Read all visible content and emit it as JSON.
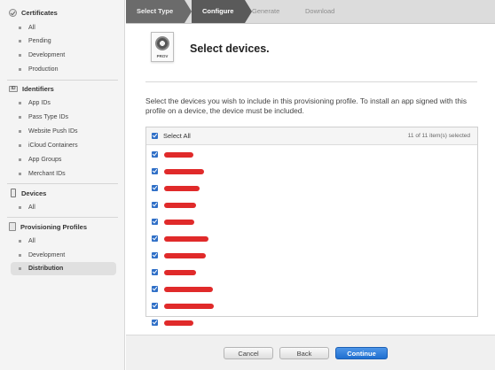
{
  "sidebar": {
    "sections": [
      {
        "title": "Certificates",
        "icon": "certificate-icon",
        "items": [
          "All",
          "Pending",
          "Development",
          "Production"
        ]
      },
      {
        "title": "Identifiers",
        "icon": "id-card-icon",
        "items": [
          "App IDs",
          "Pass Type IDs",
          "Website Push IDs",
          "iCloud Containers",
          "App Groups",
          "Merchant IDs"
        ]
      },
      {
        "title": "Devices",
        "icon": "iphone-icon",
        "items": [
          "All"
        ]
      },
      {
        "title": "Provisioning Profiles",
        "icon": "provisioning-profile-icon",
        "items": [
          "All",
          "Development",
          "Distribution"
        ]
      }
    ],
    "active_item": "Distribution"
  },
  "steps": [
    "Select Type",
    "Configure",
    "Generate",
    "Download"
  ],
  "current_step": "Configure",
  "header": {
    "icon_label": "PROV",
    "title": "Select devices."
  },
  "description": "Select the devices you wish to include in this provisioning profile. To install an app signed with this profile on a device, the device must be included.",
  "device_list": {
    "select_all_label": "Select All",
    "selection_count": "11 of 11 item(s) selected",
    "redaction_color": "#e02a2a",
    "checkbox_color": "#2f6fc7",
    "devices": [
      {
        "name": "",
        "checked": true
      },
      {
        "name": "",
        "checked": true
      },
      {
        "name": "",
        "checked": true
      },
      {
        "name": "",
        "checked": true
      },
      {
        "name": "",
        "checked": true
      },
      {
        "name": "",
        "checked": true
      },
      {
        "name": "",
        "checked": true
      },
      {
        "name": "",
        "checked": true
      },
      {
        "name": "",
        "checked": true
      },
      {
        "name": "",
        "checked": true
      },
      {
        "name": "",
        "checked": true
      }
    ]
  },
  "buttons": {
    "cancel": "Cancel",
    "back": "Back",
    "continue": "Continue"
  }
}
